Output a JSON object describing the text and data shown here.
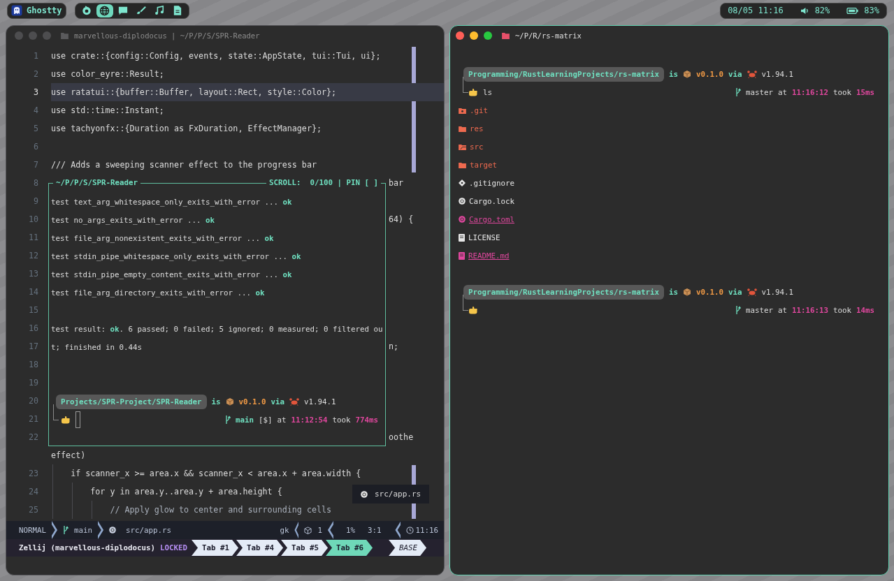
{
  "topbar": {
    "app": {
      "label": "Ghostty"
    },
    "launcher": [
      {
        "kind": "swirl",
        "selected": false
      },
      {
        "kind": "globe",
        "selected": true
      },
      {
        "kind": "chat",
        "selected": false
      },
      {
        "kind": "brush",
        "selected": false
      },
      {
        "kind": "music",
        "selected": false
      },
      {
        "kind": "document",
        "selected": false
      }
    ],
    "status": {
      "datetime": "08/05 11:16",
      "volume": "82%",
      "battery": "83%"
    }
  },
  "editor_window": {
    "focused": false,
    "title": "marvellous-diplodocus | ~/P/P/S/SPR-Reader",
    "lines": [
      {
        "number": "1",
        "current": false,
        "kind": "code",
        "text": "use crate::{config::Config, events, state::AppState, tui::Tui, ui};"
      },
      {
        "number": "2",
        "current": false,
        "kind": "code",
        "text": "use color_eyre::Result;"
      },
      {
        "number": "3",
        "current": true,
        "kind": "code",
        "text": "use ratatui::{buffer::Buffer, layout::Rect, style::Color};"
      },
      {
        "number": "4",
        "current": false,
        "kind": "code",
        "text": "use std::time::Instant;"
      },
      {
        "number": "5",
        "current": false,
        "kind": "code",
        "text": "use tachyonfx::{Duration as FxDuration, EffectManager};"
      },
      {
        "number": "6",
        "current": false
      },
      {
        "number": "7",
        "current": false,
        "kind": "code",
        "text": "/// Adds a sweeping scanner effect to the progress bar"
      },
      {
        "number": "8",
        "current": false,
        "tail": "bar"
      },
      {
        "number": "9",
        "current": false
      },
      {
        "number": "10",
        "current": false,
        "tail": "64) {"
      },
      {
        "number": "11",
        "current": false
      },
      {
        "number": "12",
        "current": false
      },
      {
        "number": "13",
        "current": false
      },
      {
        "number": "14",
        "current": false
      },
      {
        "number": "15",
        "current": false
      },
      {
        "number": "16",
        "current": false
      },
      {
        "number": "17",
        "current": false,
        "tail": "n;"
      },
      {
        "number": "18",
        "current": false
      },
      {
        "number": "19",
        "current": false
      },
      {
        "number": "20",
        "current": false
      },
      {
        "number": "21",
        "current": false
      },
      {
        "number": "22",
        "current": false,
        "tail": "oothe"
      },
      {
        "current": false,
        "kind": "code",
        "text": "effect)"
      },
      {
        "number": "23",
        "current": false,
        "kind": "code",
        "text": "    if scanner_x >= area.x && scanner_x < area.x + area.width {"
      },
      {
        "number": "24",
        "current": false,
        "kind": "code",
        "text": "        for y in area.y..area.y + area.height {"
      },
      {
        "number": "25",
        "current": false,
        "kind": "comment",
        "text": "            // Apply glow to center and surrounding cells"
      }
    ],
    "floating_pane": {
      "title": "~/P/P/S/SPR-Reader",
      "scroll": "SCROLL:  0/100 | PIN [ ]",
      "rows": [
        {
          "kind": "text",
          "segments": [
            {
              "kind": "text",
              "text": "test text_arg_whitespace_only_exits_with_error ... "
            },
            {
              "kind": "status",
              "text": "ok"
            }
          ]
        },
        {
          "kind": "text",
          "segments": [
            {
              "kind": "text",
              "text": "test no_args_exits_with_error ... "
            },
            {
              "kind": "status",
              "text": "ok"
            }
          ]
        },
        {
          "kind": "text",
          "segments": [
            {
              "kind": "text",
              "text": "test file_arg_nonexistent_exits_with_error ... "
            },
            {
              "kind": "status",
              "text": "ok"
            }
          ]
        },
        {
          "kind": "text",
          "segments": [
            {
              "kind": "text",
              "text": "test stdin_pipe_whitespace_only_exits_with_error ... "
            },
            {
              "kind": "status",
              "text": "ok"
            }
          ]
        },
        {
          "kind": "text",
          "segments": [
            {
              "kind": "text",
              "text": "test stdin_pipe_empty_content_exits_with_error ... "
            },
            {
              "kind": "status",
              "text": "ok"
            }
          ]
        },
        {
          "kind": "text",
          "segments": [
            {
              "kind": "text",
              "text": "test file_arg_directory_exits_with_error ... "
            },
            {
              "kind": "status",
              "text": "ok"
            }
          ]
        },
        {
          "kind": "blank"
        },
        {
          "kind": "text",
          "segments": [
            {
              "kind": "text",
              "text": "test result: "
            },
            {
              "kind": "status",
              "text": "ok"
            },
            {
              "kind": "text",
              "text": ". 6 passed; 0 failed; 5 ignored; 0 measured; 0 filtered ou"
            }
          ]
        },
        {
          "kind": "text",
          "segments": [
            {
              "kind": "text",
              "text": "t; finished in 0.44s"
            }
          ]
        },
        {
          "kind": "blank"
        },
        {
          "kind": "blank"
        },
        {
          "kind": "prompt",
          "line1": [
            {
              "kind": "path",
              "text": "Projects/SPR-Project/SPR-Reader"
            },
            {
              "kind": "keyword",
              "text": "is"
            },
            {
              "kind": "package"
            },
            {
              "kind": "version",
              "text": "v0.1.0"
            },
            {
              "kind": "keyword",
              "text": "via"
            },
            {
              "kind": "crab"
            },
            {
              "kind": "text",
              "text": "v1.94.1"
            }
          ],
          "line2_left": [
            {
              "kind": "hand"
            },
            {
              "kind": "cursor"
            }
          ],
          "line2_right": [
            {
              "kind": "branchmark"
            },
            {
              "kind": "branch",
              "text": "main"
            },
            {
              "kind": "text",
              "text": "[$]"
            },
            {
              "kind": "text",
              "text": "at"
            },
            {
              "kind": "time",
              "text": "11:12:54"
            },
            {
              "kind": "text",
              "text": "took"
            },
            {
              "kind": "duration",
              "text": "774ms"
            }
          ]
        }
      ]
    },
    "popup": {
      "file": "src/app.rs"
    },
    "statusline": {
      "mode": "NORMAL",
      "branch": "main",
      "file": "src/app.rs",
      "keys": "gk",
      "count": "1",
      "percent": "1%",
      "position": "3:1",
      "clock": "11:16"
    },
    "zellij": {
      "session": "Zellij (marvellous-diplodocus)",
      "mode": "LOCKED",
      "tabs": [
        {
          "label": "Tab #1",
          "selected": false
        },
        {
          "label": "Tab #4",
          "selected": false
        },
        {
          "label": "Tab #5",
          "selected": false
        },
        {
          "label": "Tab #6",
          "selected": true
        }
      ],
      "layout": "BASE"
    }
  },
  "terminal_window": {
    "focused": true,
    "title": "~/P/R/rs-matrix",
    "rows": [
      {
        "kind": "blank"
      },
      {
        "kind": "prompt",
        "line1": [
          {
            "kind": "path",
            "text": "Programming/RustLearningProjects/rs-matrix"
          },
          {
            "kind": "keyword",
            "text": "is"
          },
          {
            "kind": "package"
          },
          {
            "kind": "version",
            "text": "v0.1.0"
          },
          {
            "kind": "keyword",
            "text": "via"
          },
          {
            "kind": "crab"
          },
          {
            "kind": "text",
            "text": "v1.94.1"
          }
        ],
        "line2_left": [
          {
            "kind": "hand"
          },
          {
            "kind": "text",
            "text": "ls"
          }
        ],
        "line2_right": [
          {
            "kind": "branchmark"
          },
          {
            "kind": "text",
            "text": "master"
          },
          {
            "kind": "text",
            "text": "at"
          },
          {
            "kind": "time",
            "text": "11:16:12"
          },
          {
            "kind": "text",
            "text": "took"
          },
          {
            "kind": "duration",
            "text": "15ms"
          }
        ]
      },
      {
        "kind": "gitdir",
        "name": ".git",
        "color": "#ee6a4f",
        "underlined": false
      },
      {
        "kind": "dir",
        "name": "res",
        "color": "#ee6a4f",
        "underlined": false
      },
      {
        "kind": "srcdir",
        "name": "src",
        "color": "#ee6a4f",
        "underlined": false
      },
      {
        "kind": "dir",
        "name": "target",
        "color": "#ee6a4f",
        "underlined": false
      },
      {
        "kind": "gitignore",
        "name": ".gitignore",
        "color": "#e6e6e6",
        "underlined": false
      },
      {
        "kind": "cargo",
        "name": "Cargo.lock",
        "color": "#e6e6e6",
        "underlined": false
      },
      {
        "kind": "cargo",
        "name": "Cargo.toml",
        "color": "#e0479e",
        "underlined": true
      },
      {
        "kind": "doc",
        "name": "LICENSE",
        "color": "#e6e6e6",
        "underlined": false
      },
      {
        "kind": "doc",
        "name": "README.md",
        "color": "#e0479e",
        "underlined": true
      },
      {
        "kind": "blank"
      },
      {
        "kind": "prompt",
        "line1": [
          {
            "kind": "path",
            "text": "Programming/RustLearningProjects/rs-matrix"
          },
          {
            "kind": "keyword",
            "text": "is"
          },
          {
            "kind": "package"
          },
          {
            "kind": "version",
            "text": "v0.1.0"
          },
          {
            "kind": "keyword",
            "text": "via"
          },
          {
            "kind": "crab"
          },
          {
            "kind": "text",
            "text": "v1.94.1"
          }
        ],
        "line2_left": [
          {
            "kind": "hand"
          }
        ],
        "line2_right": [
          {
            "kind": "branchmark"
          },
          {
            "kind": "text",
            "text": "master"
          },
          {
            "kind": "text",
            "text": "at"
          },
          {
            "kind": "time",
            "text": "11:16:13"
          },
          {
            "kind": "text",
            "text": "took"
          },
          {
            "kind": "duration",
            "text": "14ms"
          }
        ]
      }
    ]
  }
}
